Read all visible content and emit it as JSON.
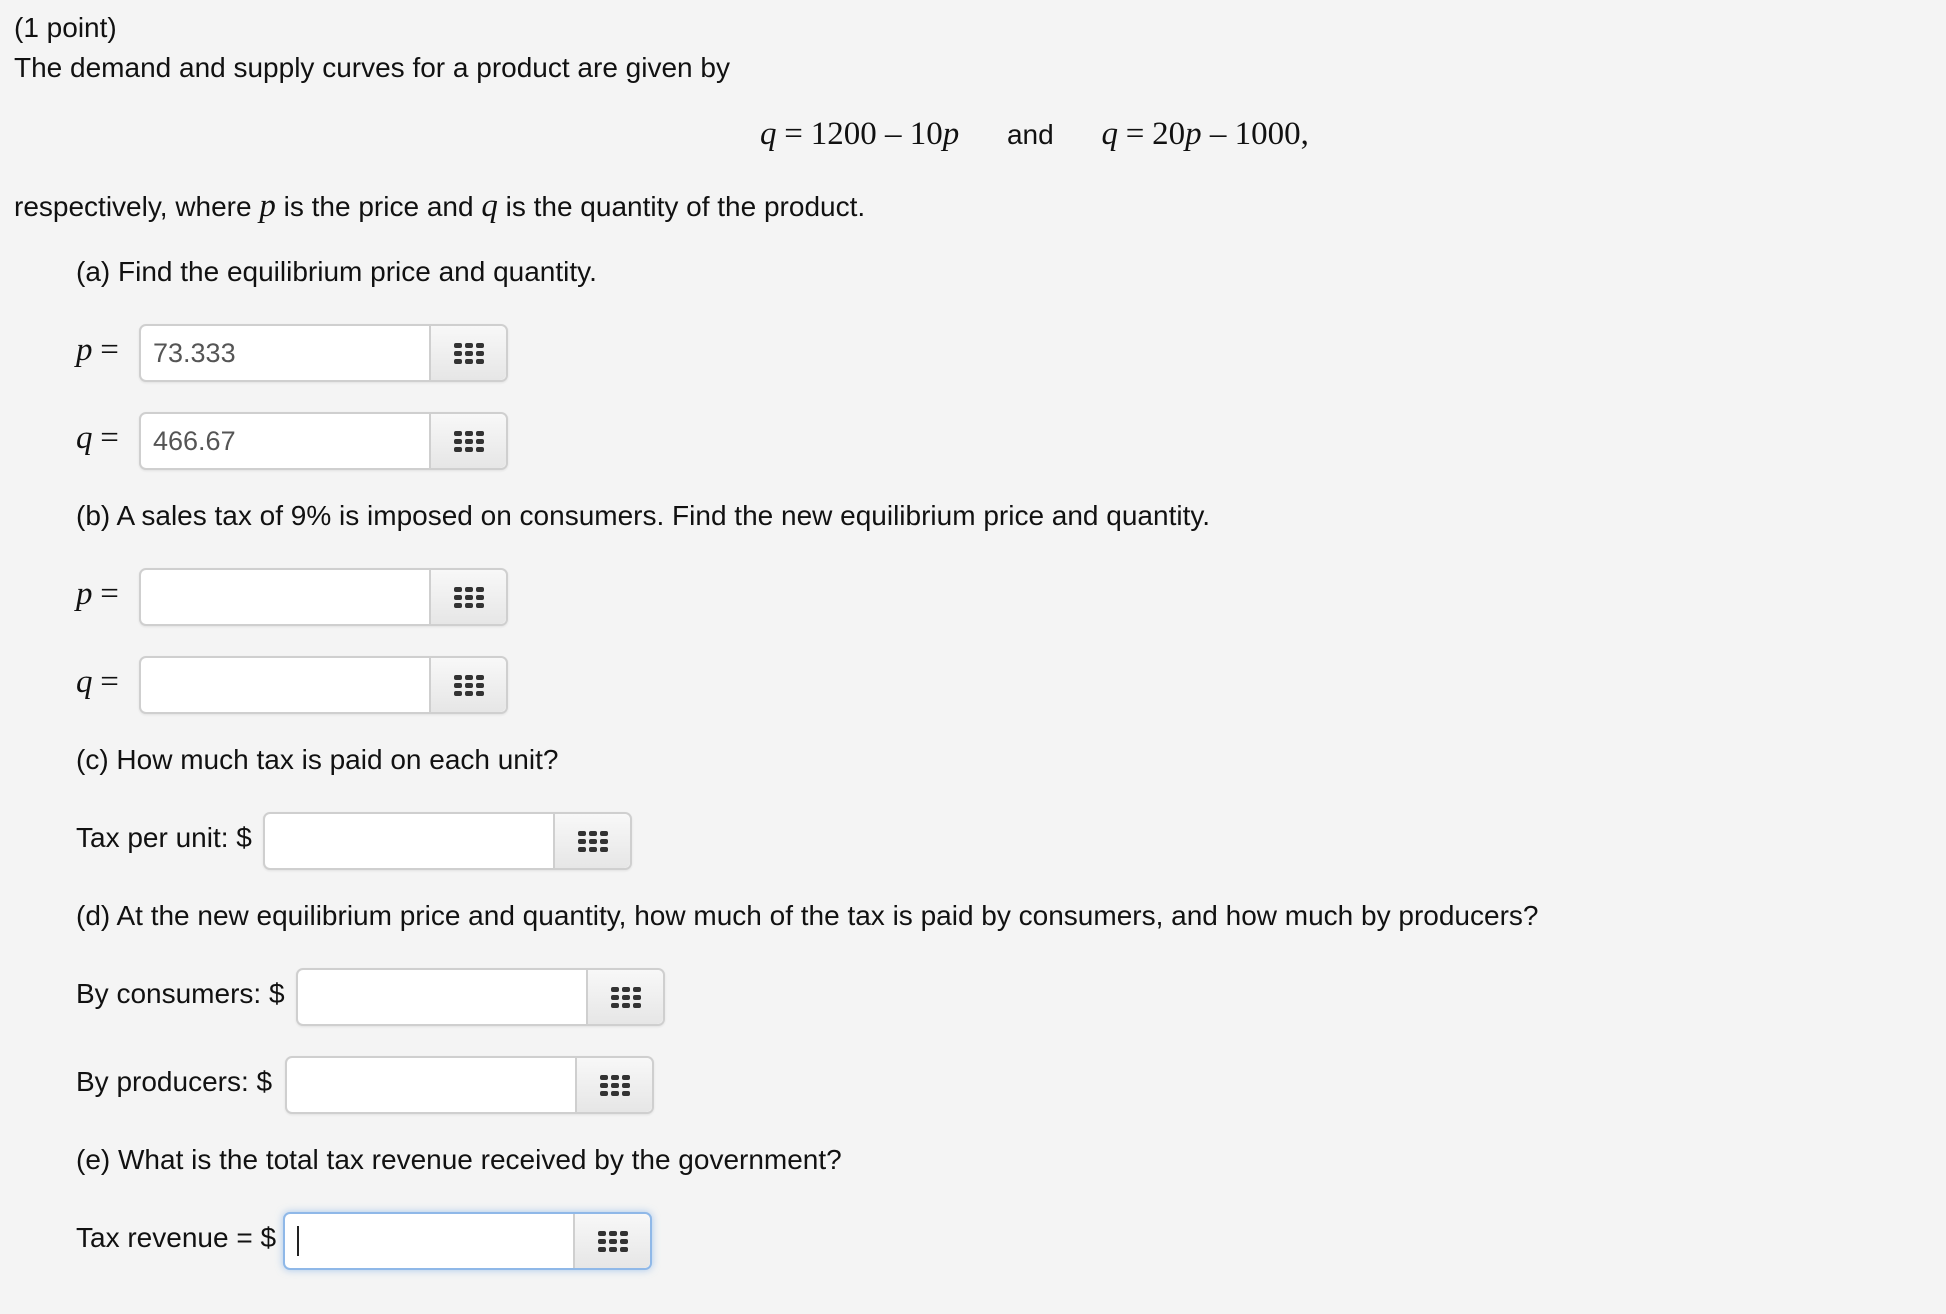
{
  "header": {
    "points": "(1 point)",
    "intro": "The demand and supply curves for a product are given by"
  },
  "equation": {
    "demand_lhs": "q",
    "demand_rhs_num": "1200 – 10",
    "demand_rhs_var": "p",
    "connector": "and",
    "supply_lhs": "q",
    "supply_rhs_num1": "20",
    "supply_rhs_var": "p",
    "supply_rhs_num2": " – 1000,",
    "equals": "="
  },
  "explanation": {
    "pre": "respectively, where",
    "p": "p",
    "mid": "is the price and",
    "q": "q",
    "post": "is the quantity of the product."
  },
  "parts": {
    "a": {
      "label": "(a)  Find the equilibrium price and quantity.",
      "p_label": "p",
      "q_label": "q",
      "equals": "=",
      "p_value": "73.333",
      "q_value": "466.67"
    },
    "b": {
      "label": "(b)  A sales tax of 9% is imposed on consumers. Find the new equilibrium price and quantity.",
      "p_label": "p",
      "q_label": "q",
      "equals": "=",
      "p_value": "",
      "q_value": ""
    },
    "c": {
      "label": "(c)  How much tax is paid on each unit?",
      "field_label": "Tax per unit: $",
      "value": ""
    },
    "d": {
      "label": "(d)  At the new equilibrium price and quantity, how much of the tax is paid by consumers, and how much by producers?",
      "consumers_label": "By consumers: $",
      "producers_label": "By producers: $",
      "consumers_value": "",
      "producers_value": ""
    },
    "e": {
      "label": "(e)  What is the total tax revenue received by the government?",
      "field_label": "Tax revenue = $",
      "value": ""
    }
  },
  "icons": {
    "equation_editor": "grid-icon"
  },
  "colors": {
    "background": "#f4f4f4",
    "focus_border": "#8fb8e8"
  }
}
